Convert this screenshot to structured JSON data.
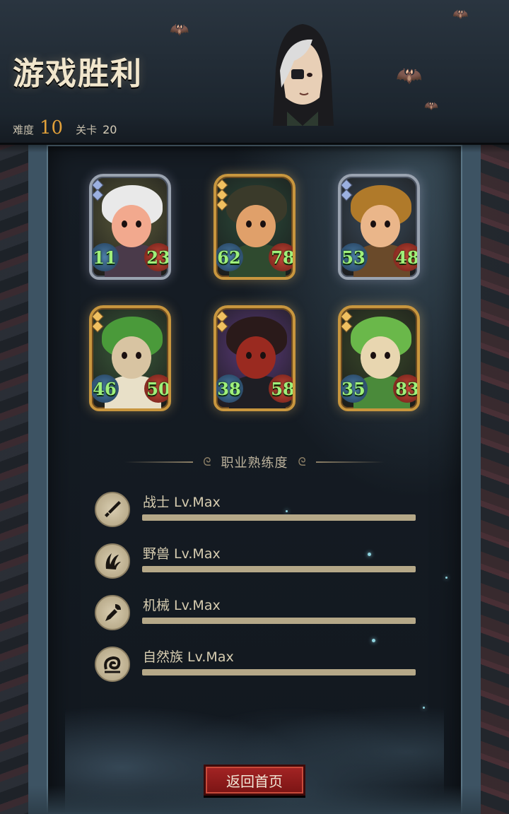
{
  "header": {
    "title": "游戏胜利",
    "difficulty_label": "难度",
    "difficulty_value": "10",
    "level_label": "关卡",
    "level_value": "20"
  },
  "cards": [
    {
      "attack": "11",
      "health": "23",
      "frame": "silver",
      "gems": 2
    },
    {
      "attack": "62",
      "health": "78",
      "frame": "gold",
      "gems": 3
    },
    {
      "attack": "53",
      "health": "48",
      "frame": "silver",
      "gems": 2
    },
    {
      "attack": "46",
      "health": "50",
      "frame": "gold",
      "gems": 2
    },
    {
      "attack": "38",
      "health": "58",
      "frame": "gold",
      "gems": 2
    },
    {
      "attack": "35",
      "health": "83",
      "frame": "gold",
      "gems": 2
    }
  ],
  "mastery": {
    "title": "职业熟练度",
    "items": [
      {
        "label": "战士 Lv.Max",
        "icon": "sword-icon",
        "progress": 1.0
      },
      {
        "label": "野兽 Lv.Max",
        "icon": "beast-claw-icon",
        "progress": 1.0
      },
      {
        "label": "机械 Lv.Max",
        "icon": "wrench-icon",
        "progress": 1.0
      },
      {
        "label": "自然族 Lv.Max",
        "icon": "nature-swirl-icon",
        "progress": 1.0
      }
    ]
  },
  "buttons": {
    "home_label": "返回首页"
  },
  "colors": {
    "accent_orange": "#e2a13a",
    "stat_green": "#9ff07a",
    "button_red": "#a42424",
    "frame_gold": "#c8963e",
    "frame_silver": "#9aa3b0"
  }
}
